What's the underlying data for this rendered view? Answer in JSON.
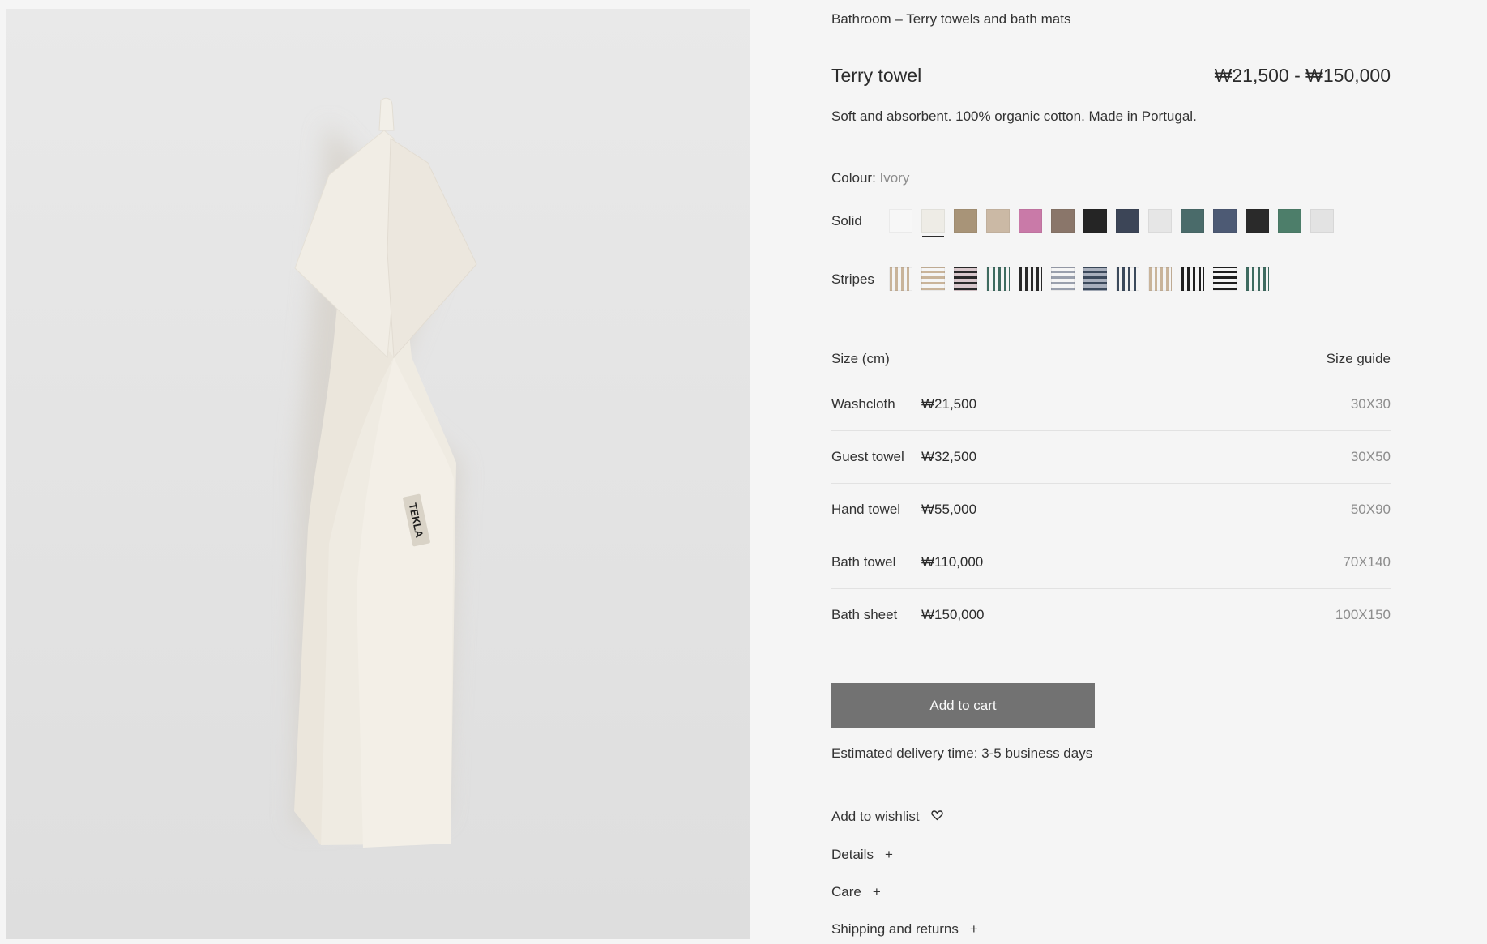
{
  "breadcrumb": "Bathroom – Terry towels and bath mats",
  "product": {
    "title": "Terry towel",
    "price_range": "₩21,500 - ₩150,000",
    "description": "Soft and absorbent. 100% organic cotton. Made in Portugal.",
    "image": {
      "label_text": "TEKLA"
    }
  },
  "colour": {
    "label": "Colour:",
    "selected": "Ivory",
    "solid_label": "Solid",
    "stripes_label": "Stripes",
    "solid_swatches": [
      "#f7f7f7",
      "#eeece6",
      "#a89478",
      "#cbb9a5",
      "#c97aa8",
      "#8a766a",
      "#252525",
      "#3c4557",
      "#e6e6e6",
      "#4a6b6a",
      "#4d5a74",
      "#2a2a2a",
      "#4d7e6a",
      "#e3e3e3"
    ],
    "stripe_swatches": [
      {
        "a": "#c9b49a",
        "b": "#f5f5f5",
        "dir": "v"
      },
      {
        "a": "#c9b49a",
        "b": "#f5f5f5",
        "dir": "h"
      },
      {
        "a": "#2a2a2a",
        "b": "#d9c8cc",
        "dir": "h"
      },
      {
        "a": "#3e6b60",
        "b": "#f5f5f5",
        "dir": "v"
      },
      {
        "a": "#2a2a2a",
        "b": "#f5f5f5",
        "dir": "v"
      },
      {
        "a": "#9aa0ad",
        "b": "#f5f5f5",
        "dir": "h"
      },
      {
        "a": "#3c4a5c",
        "b": "#a9b0bd",
        "dir": "h"
      },
      {
        "a": "#3c4a5c",
        "b": "#f5f5f5",
        "dir": "v"
      },
      {
        "a": "#c9b49a",
        "b": "#f5f5f5",
        "dir": "v"
      },
      {
        "a": "#1f1f1f",
        "b": "#f5f5f5",
        "dir": "v"
      },
      {
        "a": "#1f1f1f",
        "b": "#f5f5f5",
        "dir": "h"
      },
      {
        "a": "#3e6b60",
        "b": "#f5f5f5",
        "dir": "v"
      }
    ],
    "selected_solid_index": 1
  },
  "sizes": {
    "heading": "Size (cm)",
    "guide": "Size guide",
    "rows": [
      {
        "name": "Washcloth",
        "price": "₩21,500",
        "dim": "30X30"
      },
      {
        "name": "Guest towel",
        "price": "₩32,500",
        "dim": "30X50"
      },
      {
        "name": "Hand towel",
        "price": "₩55,000",
        "dim": "50X90"
      },
      {
        "name": "Bath towel",
        "price": "₩110,000",
        "dim": "70X140"
      },
      {
        "name": "Bath sheet",
        "price": "₩150,000",
        "dim": "100X150"
      }
    ]
  },
  "cart_button": "Add to cart",
  "delivery": "Estimated delivery time: 3-5 business days",
  "wishlist": "Add to wishlist",
  "accordions": [
    {
      "label": "Details",
      "icon": "+"
    },
    {
      "label": "Care",
      "icon": "+"
    },
    {
      "label": "Shipping and returns",
      "icon": "+"
    }
  ]
}
